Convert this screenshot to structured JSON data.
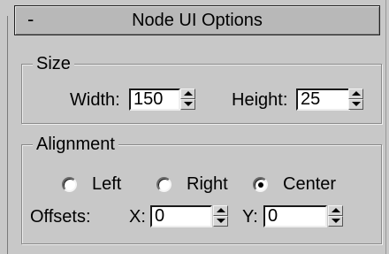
{
  "rollout": {
    "collapse_symbol": "-",
    "title": "Node UI Options"
  },
  "size_group": {
    "title": "Size",
    "width_label": "Width:",
    "width_value": "150",
    "height_label": "Height:",
    "height_value": "25"
  },
  "alignment_group": {
    "title": "Alignment",
    "options": [
      {
        "label": "Left",
        "selected": false
      },
      {
        "label": "Right",
        "selected": false
      },
      {
        "label": "Center",
        "selected": true
      }
    ],
    "offsets_label": "Offsets:",
    "x_label": "X:",
    "x_value": "0",
    "y_label": "Y:",
    "y_value": "0"
  }
}
